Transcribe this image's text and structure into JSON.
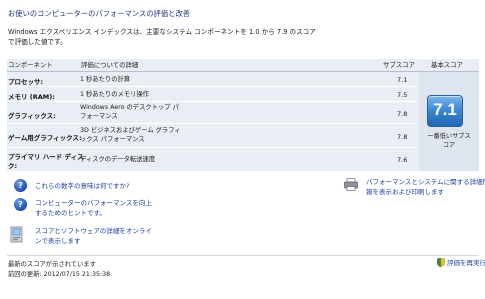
{
  "page": {
    "title": "お使いのコンピューターのパフォーマンスの評価と改善",
    "intro": "Windows エクスペリエンス インデックスは、主要なシステム コンポーネントを 1.0 から 7.9 のスコアで評価した値です。"
  },
  "table": {
    "headers": {
      "component": "コンポーネント",
      "detail": "評価についての詳細",
      "subscore": "サブスコア",
      "base": "基本スコア"
    },
    "rows": [
      {
        "component": "プロセッサ:",
        "detail": "1 秒あたりの計算",
        "subscore": "7.1"
      },
      {
        "component": "メモリ (RAM):",
        "detail": "1 秒あたりのメモリ操作",
        "subscore": "7.5"
      },
      {
        "component": "グラフィックス:",
        "detail_line1": "Windows Aero のデスクトップ パ",
        "detail_line2": "フォーマンス",
        "subscore": "7.8"
      },
      {
        "component": "ゲーム用グラフィックス:",
        "detail_line1": "3D ビジネスおよびゲーム グラフィ",
        "detail_line2": "ックス パフォーマンス",
        "subscore": "7.8"
      },
      {
        "component_line1": "プライマリ ハード ディス",
        "component_line2": "ク:",
        "detail": "ディスクのデータ転送速度",
        "subscore": "7.6"
      }
    ],
    "base_score": "7.1",
    "base_caption_line1": "一番低いサブス",
    "base_caption_line2": "コア"
  },
  "links": {
    "meaning": "これらの数字の意味は何ですか?",
    "tips_line1": "コンピューターのパフォーマンスを向上",
    "tips_line2": "するためのヒントです。",
    "online_line1": "スコアとソフトウェアの詳細をオンライ",
    "online_line2": "ンで表示します",
    "print_line1": "パフォーマンスとシステムに関する詳細情",
    "print_line2": "報を表示および印刷します"
  },
  "footer": {
    "status": "最新のスコアが示されています",
    "last_updated": "前回の更新: 2012/07/15 21:35:38",
    "rerun": "評価を再実行"
  },
  "colors": {
    "title": "#1e3287",
    "link": "#1e3ea8",
    "panel": "#e9edf4",
    "tile": "#2f78c6"
  }
}
